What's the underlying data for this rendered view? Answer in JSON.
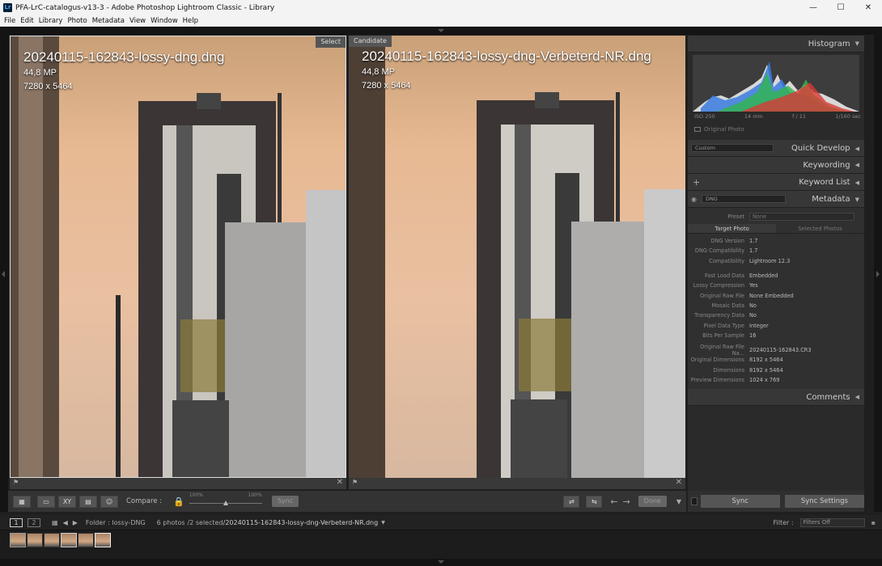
{
  "window": {
    "title": "PFA-LrC-catalogus-v13-3 - Adobe Photoshop Lightroom Classic - Library",
    "minimize": "—",
    "maximize": "☐",
    "close": "✕"
  },
  "menu": [
    "File",
    "Edit",
    "Library",
    "Photo",
    "Metadata",
    "View",
    "Window",
    "Help"
  ],
  "left_photo": {
    "tag": "Select",
    "filename": "20240115-162843-lossy-dng.dng",
    "megapixels": "44,8 MP",
    "dimensions": "7280 x 5464"
  },
  "right_photo": {
    "tag": "Candidate",
    "filename": "20240115-162843-lossy-dng-Verbeterd-NR.dng",
    "megapixels": "44,8 MP",
    "dimensions": "7280 x 5464"
  },
  "toolbar": {
    "compare_label": "Compare :",
    "zoom_left": "100%",
    "zoom_right": "100%",
    "zoom_slider_level": 0.5,
    "sync_label": "Sync",
    "done_label": "Done"
  },
  "right_panel": {
    "histogram": {
      "title": "Histogram",
      "iso": "ISO 250",
      "focal": "14 mm",
      "aperture": "f / 11",
      "shutter": "1/160 sec",
      "original_photo_label": "Original Photo"
    },
    "quick_develop": {
      "title": "Quick Develop",
      "preset": "Custom"
    },
    "keywording": {
      "title": "Keywording"
    },
    "keyword_list": {
      "title": "Keyword List"
    },
    "metadata": {
      "title": "Metadata",
      "view": "DNG",
      "preset_label": "Preset",
      "preset_value": "None",
      "tab_target": "Target Photo",
      "tab_selected": "Selected Photos",
      "group1": [
        {
          "k": "DNG Version",
          "v": "1.7"
        },
        {
          "k": "DNG Compatibility",
          "v": "1.7"
        },
        {
          "k": "Compatibility",
          "v": "Lightroom 12.3"
        }
      ],
      "group2": [
        {
          "k": "Fast Load Data",
          "v": "Embedded"
        },
        {
          "k": "Lossy Compression",
          "v": "Yes"
        },
        {
          "k": "Original Raw File",
          "v": "None Embedded"
        },
        {
          "k": "Mosaic Data",
          "v": "No"
        },
        {
          "k": "Transparency Data",
          "v": "No"
        },
        {
          "k": "Pixel Data Type",
          "v": "Integer"
        },
        {
          "k": "Bits Per Sample",
          "v": "16"
        }
      ],
      "group3": [
        {
          "k": "Original Raw File Na...",
          "v": "20240115-162843.CR3"
        },
        {
          "k": "Original Dimensions",
          "v": "8192 x 5464"
        },
        {
          "k": "Dimensions",
          "v": "8192 x 5464"
        },
        {
          "k": "Preview Dimensions",
          "v": "1024 x 769"
        }
      ]
    },
    "comments": {
      "title": "Comments"
    },
    "sync_label": "Sync",
    "sync_settings_label": "Sync Settings"
  },
  "filmstrip_bar": {
    "view1": "1",
    "view2": "2",
    "folder": "Folder : lossy-DNG",
    "count": "6 photos",
    "selected": "/2 selected",
    "current_file": "/20240115-162843-lossy-dng-Verbeterd-NR.dng",
    "filter_label": "Filter :",
    "filter_value": "Filters Off"
  },
  "colors": {
    "panel_bg": "#2a2a2a",
    "panel_header": "#373737",
    "sky_top": "#c9a078",
    "sky_mid": "#e9c0a1"
  }
}
